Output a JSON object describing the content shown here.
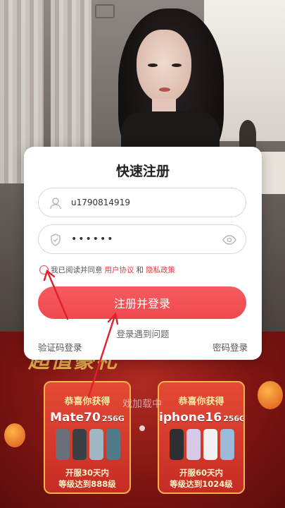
{
  "modal": {
    "title": "快速注册",
    "username_value": "u1790814919",
    "password_value": "••••••",
    "agreement": {
      "prefix": "我已阅读并同意",
      "terms_link": "用户协议",
      "conjunction": "和",
      "privacy_link": "隐私政策"
    },
    "submit_label": "注册并登录",
    "login_issue": "登录遇到问题",
    "sms_login": "验证码登录",
    "password_login": "密码登录"
  },
  "background": {
    "loading_text": "戏加载中",
    "banner_text": "超值豪礼",
    "cards": [
      {
        "header": "恭喜你获得",
        "product": "Mate70",
        "storage": "256G",
        "footer_line1": "开服30天内",
        "footer_line2": "等级达到888级"
      },
      {
        "header": "恭喜你获得",
        "product": "iphone16",
        "storage": "256G",
        "footer_line1": "开服60天内",
        "footer_line2": "等级达到1024级"
      }
    ]
  },
  "colors": {
    "accent": "#EF4A4F",
    "link": "#E83B3F",
    "annotation": "#E0202A"
  },
  "icons": [
    "user-icon",
    "shield-icon",
    "eye-icon"
  ]
}
